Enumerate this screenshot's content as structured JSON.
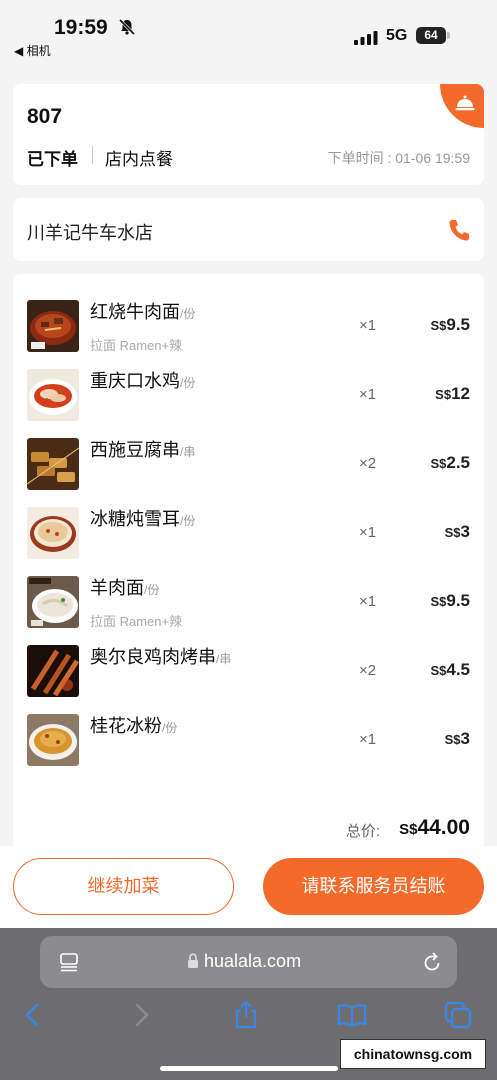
{
  "status_bar": {
    "time": "19:59",
    "back_app": "◀ 相机",
    "network": "5G",
    "battery": "64"
  },
  "order": {
    "number": "807",
    "status": "已下单",
    "type": "店内点餐",
    "time_label": "下单时间 : 01-06 19:59"
  },
  "store": {
    "name": "川羊记牛车水店"
  },
  "items": [
    {
      "name": "红烧牛肉面",
      "unit": "/份",
      "sub": "拉面 Ramen+辣",
      "qty": "×1",
      "currency": "S$",
      "price": "9.5"
    },
    {
      "name": "重庆口水鸡",
      "unit": "/份",
      "sub": "",
      "qty": "×1",
      "currency": "S$",
      "price": "12"
    },
    {
      "name": "西施豆腐串",
      "unit": "/串",
      "sub": "",
      "qty": "×2",
      "currency": "S$",
      "price": "2.5"
    },
    {
      "name": "冰糖炖雪耳",
      "unit": "/份",
      "sub": "",
      "qty": "×1",
      "currency": "S$",
      "price": "3"
    },
    {
      "name": "羊肉面",
      "unit": "/份",
      "sub": "拉面 Ramen+辣",
      "qty": "×1",
      "currency": "S$",
      "price": "9.5"
    },
    {
      "name": "奥尔良鸡肉烤串",
      "unit": "/串",
      "sub": "",
      "qty": "×2",
      "currency": "S$",
      "price": "4.5"
    },
    {
      "name": "桂花冰粉",
      "unit": "/份",
      "sub": "",
      "qty": "×1",
      "currency": "S$",
      "price": "3"
    }
  ],
  "total": {
    "label": "总价:",
    "currency": "S$",
    "value": "44.00"
  },
  "actions": {
    "add_more": "继续加菜",
    "checkout": "请联系服务员结账"
  },
  "browser": {
    "url": "hualala.com"
  },
  "watermark": "chinatownsg.com",
  "colors": {
    "accent": "#f36a2a",
    "background": "#f4f4f4",
    "browser_bar": "#6d6d6f",
    "icon_blue": "#3a86e8"
  },
  "icons": [
    "bell-slash-icon",
    "signal-icon",
    "battery-icon",
    "service-bell-icon",
    "phone-icon",
    "reader-icon",
    "lock-icon",
    "reload-icon",
    "back-icon",
    "forward-icon",
    "share-icon",
    "bookmarks-icon",
    "tabs-icon"
  ]
}
